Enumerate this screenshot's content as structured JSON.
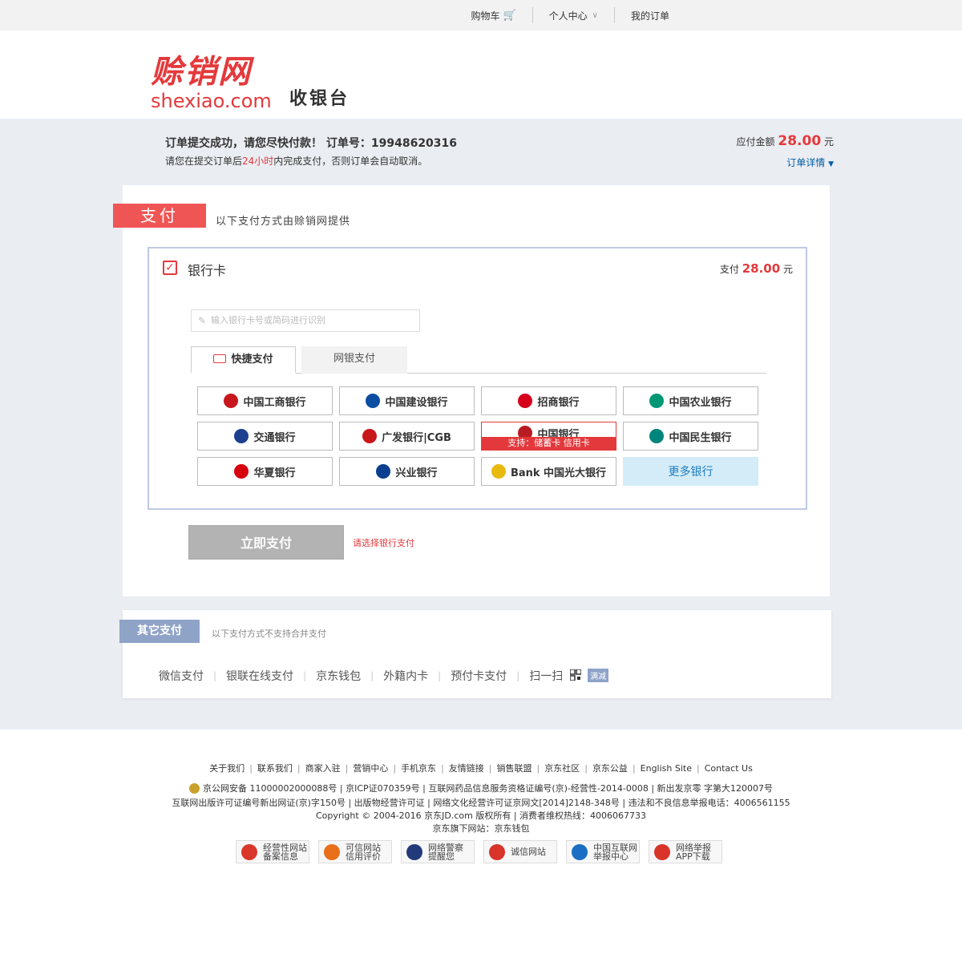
{
  "topnav": {
    "cart": "购物车",
    "user_center": "个人中心",
    "my_orders": "我的订单"
  },
  "header": {
    "logo_cn": "赊销网",
    "logo_en": "shexiao.com",
    "title": "收银台"
  },
  "order": {
    "line1": "订单提交成功，请您尽快付款！ 订单号：19948620316",
    "line2_pre": "请您在提交订单后",
    "line2_time": "24小时",
    "line2_post": "内完成支付，否则订单会自动取消。",
    "amount_label": "应付金额",
    "amount": "28.00",
    "amount_unit": "元",
    "detail_link": "订单详情"
  },
  "payment": {
    "tag": "支付",
    "subtitle": "以下支付方式由赊销网提供",
    "bank_card_label": "银行卡",
    "pay_label": "支付",
    "pay_amount": "28.00",
    "pay_unit": "元",
    "card_input_placeholder": "输入银行卡号或简码进行识别",
    "tabs": [
      "快捷支付",
      "网银支付"
    ],
    "banks": [
      {
        "name": "中国工商银行",
        "color": "#c8161d"
      },
      {
        "name": "中国建设银行",
        "color": "#0c4da2"
      },
      {
        "name": "招商银行",
        "color": "#d6001c"
      },
      {
        "name": "中国农业银行",
        "color": "#009775"
      },
      {
        "name": "交通银行",
        "color": "#1d3f8f"
      },
      {
        "name": "广发银行|CGB",
        "color": "#c8161d"
      },
      {
        "name": "中国银行",
        "color": "#b81c22"
      },
      {
        "name": "中国民生银行",
        "color": "#00857c"
      },
      {
        "name": "华夏银行",
        "color": "#d7000f"
      },
      {
        "name": "兴业银行",
        "color": "#0c3f8f"
      },
      {
        "name": "Bank 中国光大银行",
        "color": "#e8b90f"
      },
      {
        "name": "更多银行",
        "color": "#1f7bbf"
      }
    ],
    "selected_support": "支持：储蓄卡 信用卡",
    "pay_button": "立即支付",
    "pay_hint": "请选择银行支付"
  },
  "other": {
    "tag": "其它支付",
    "subtitle": "以下支付方式不支持合并支付",
    "methods": [
      "微信支付",
      "银联在线支付",
      "京东钱包",
      "外籍内卡",
      "预付卡支付",
      "扫一扫"
    ],
    "badge": "满减"
  },
  "footer": {
    "links": [
      "关于我们",
      "联系我们",
      "商家入驻",
      "营销中心",
      "手机京东",
      "友情链接",
      "销售联盟",
      "京东社区",
      "京东公益",
      "English Site",
      "Contact Us"
    ],
    "line1": "京公网安备 11000002000088号 | 京ICP证070359号 | 互联网药品信息服务资格证编号(京)-经营性-2014-0008 | 新出发京零 字第大120007号",
    "line2": "互联网出版许可证编号新出网证(京)字150号 | 出版物经营许可证 | 网络文化经营许可证京网文[2014]2148-348号 | 违法和不良信息举报电话：4006561155",
    "line3": "Copyright © 2004-2016  京东JD.com 版权所有 | 消费者维权热线：4006067733",
    "line4": "京东旗下网站：京东钱包",
    "badges": [
      {
        "l1": "经营性网站",
        "l2": "备案信息",
        "color": "#d9372b"
      },
      {
        "l1": "可信网站",
        "l2": "信用评价",
        "color": "#e96f1a"
      },
      {
        "l1": "网络警察",
        "l2": "提醒您",
        "color": "#223a7a"
      },
      {
        "l1": "诚信网站",
        "l2": "",
        "color": "#d8342a"
      },
      {
        "l1": "中国互联网",
        "l2": "举报中心",
        "color": "#1a6fc4"
      },
      {
        "l1": "网络举报",
        "l2": "APP下载",
        "color": "#d8342a"
      }
    ]
  }
}
